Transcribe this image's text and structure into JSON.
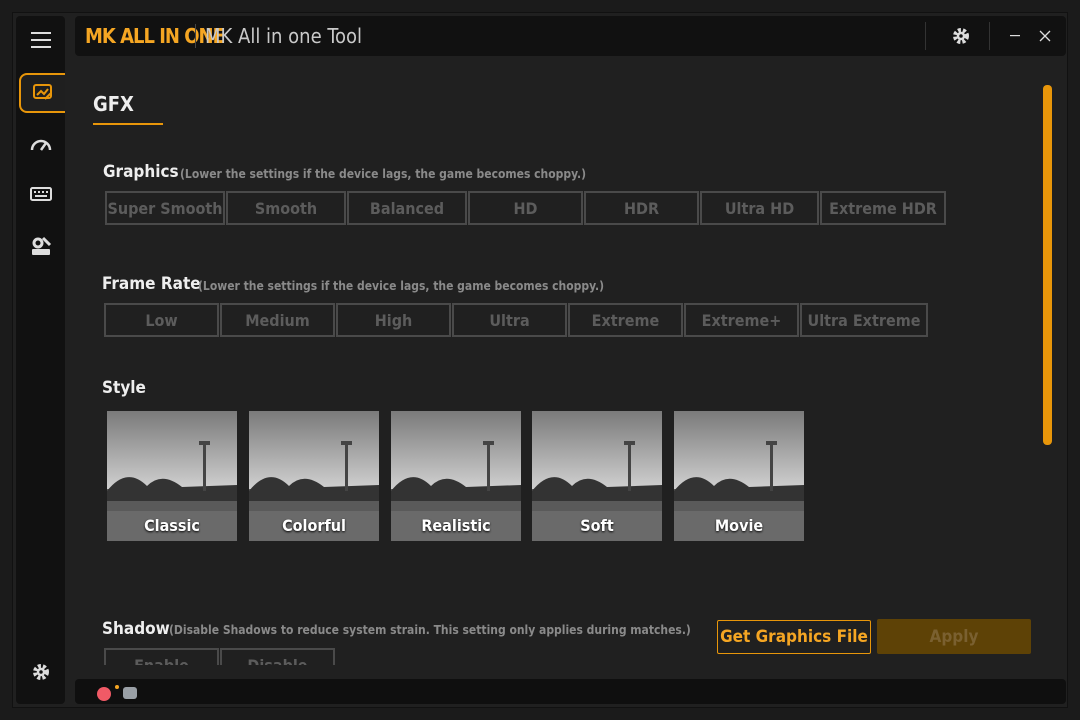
{
  "brand": "MK ALL IN ONE",
  "app_title": "MK All in one Tool",
  "tab": {
    "title": "GFX"
  },
  "graphics": {
    "label": "Graphics",
    "hint": "(Lower the settings if the device lags, the game becomes choppy.)",
    "options": [
      "Super Smooth",
      "Smooth",
      "Balanced",
      "HD",
      "HDR",
      "Ultra HD",
      "Extreme HDR"
    ]
  },
  "frame_rate": {
    "label": "Frame Rate",
    "hint": "(Lower the settings if the device lags, the game becomes choppy.)",
    "options": [
      "Low",
      "Medium",
      "High",
      "Ultra",
      "Extreme",
      "Extreme+",
      "Ultra Extreme"
    ]
  },
  "style": {
    "label": "Style",
    "options": [
      "Classic",
      "Colorful",
      "Realistic",
      "Soft",
      "Movie"
    ]
  },
  "shadow": {
    "label": "Shadow",
    "hint": "(Disable Shadows to reduce system strain. This setting only applies during matches.)",
    "options": [
      "Enable",
      "Disable"
    ]
  },
  "buttons": {
    "get_graphics": "Get Graphics File",
    "apply": "Apply"
  },
  "sidebar": {
    "items": [
      {
        "name": "menu-icon"
      },
      {
        "name": "gfx-icon",
        "active": true
      },
      {
        "name": "speedometer-icon"
      },
      {
        "name": "keyboard-icon"
      },
      {
        "name": "tools-icon"
      },
      {
        "name": "settings-icon"
      }
    ]
  },
  "colors": {
    "accent": "#e8960a",
    "background": "#202020",
    "panel": "#111111"
  }
}
